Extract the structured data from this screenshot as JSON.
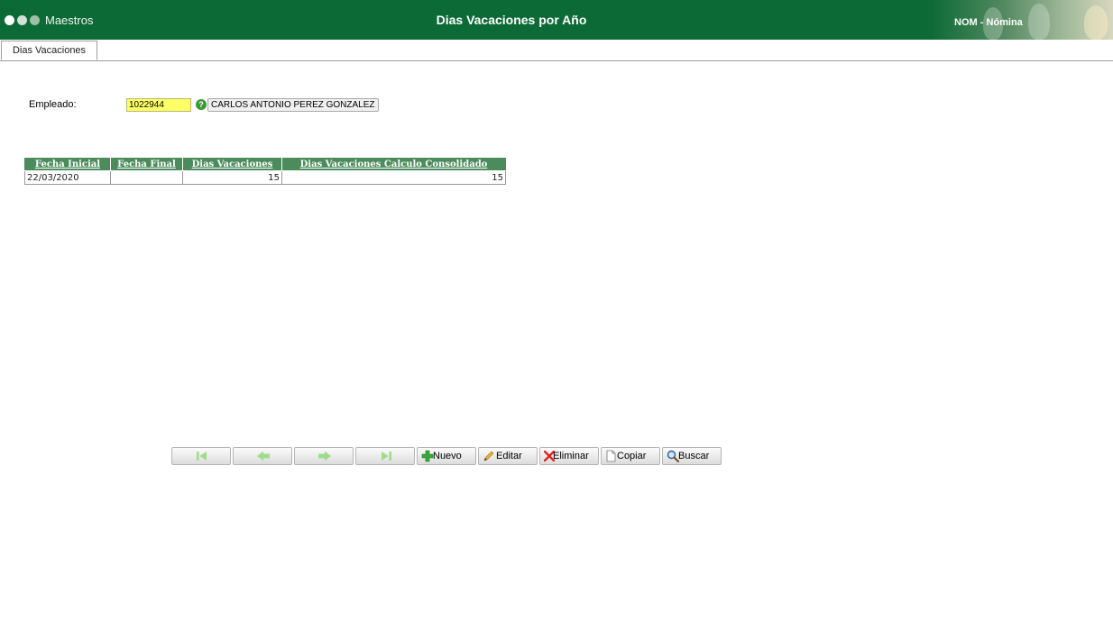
{
  "header": {
    "app_title": "Maestros",
    "page_title": "Dias Vacaciones por Año",
    "module": "NOM - Nómina",
    "color": "#0b6a36"
  },
  "tabs": [
    {
      "label": "Dias Vacaciones",
      "active": true
    }
  ],
  "employee": {
    "label": "Empleado:",
    "code": "1022944",
    "name": "CARLOS ANTONIO PEREZ GONZALEZ",
    "help_icon": "question-icon"
  },
  "grid": {
    "header_color": "#4b8b5c",
    "columns": [
      "Fecha Inicial",
      "Fecha Final",
      "Dias Vacaciones",
      "Dias Vacaciones Calculo Consolidado"
    ],
    "rows": [
      [
        "22/03/2020",
        "",
        "15",
        "15"
      ]
    ]
  },
  "toolbar": {
    "first_icon": "first-page-icon",
    "prev_icon": "previous-arrow-icon",
    "next_icon": "next-arrow-icon",
    "last_icon": "last-page-icon",
    "nuevo": "Nuevo",
    "editar": "Editar",
    "eliminar": "Eliminar",
    "copiar": "Copiar",
    "buscar": "Buscar"
  }
}
